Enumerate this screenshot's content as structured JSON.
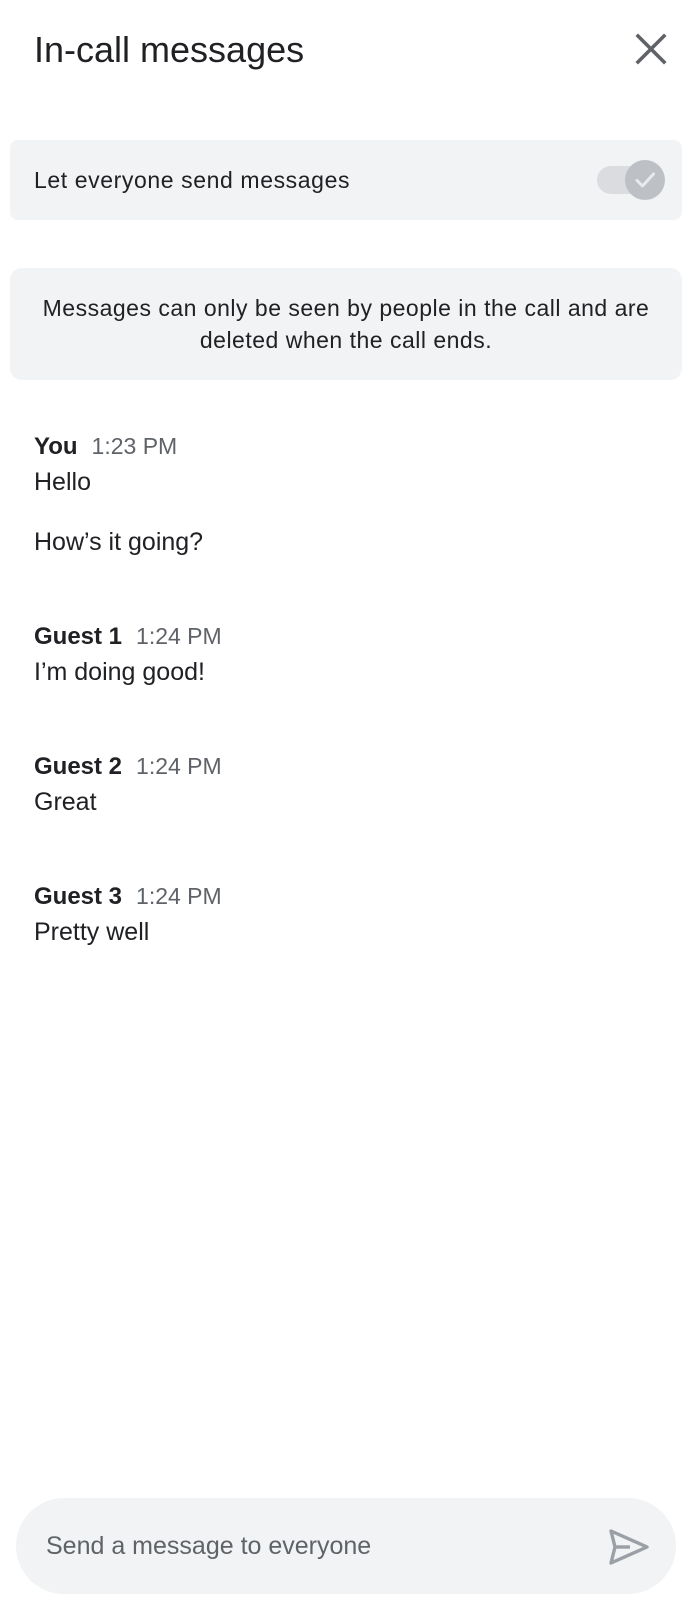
{
  "header": {
    "title": "In-call messages",
    "close_icon": "close-icon"
  },
  "settings": {
    "let_everyone_send_label": "Let everyone send messages",
    "let_everyone_send_enabled": true,
    "toggle_icon": "check-icon"
  },
  "notice": {
    "text": "Messages can only be seen by people in the call and are deleted when the call ends."
  },
  "messages": [
    {
      "sender": "You",
      "time": "1:23 PM",
      "texts": [
        "Hello",
        "How’s it going?"
      ]
    },
    {
      "sender": "Guest 1",
      "time": "1:24 PM",
      "texts": [
        "I’m doing good!"
      ]
    },
    {
      "sender": "Guest 2",
      "time": "1:24 PM",
      "texts": [
        "Great"
      ]
    },
    {
      "sender": "Guest 3",
      "time": "1:24 PM",
      "texts": [
        "Pretty well"
      ]
    }
  ],
  "composer": {
    "placeholder": "Send a message to everyone",
    "value": "",
    "send_icon": "send-icon"
  },
  "colors": {
    "surface": "#f1f3f4",
    "text_primary": "#202124",
    "text_secondary": "#5f6368",
    "toggle_disabled": "#bdc1c6"
  }
}
